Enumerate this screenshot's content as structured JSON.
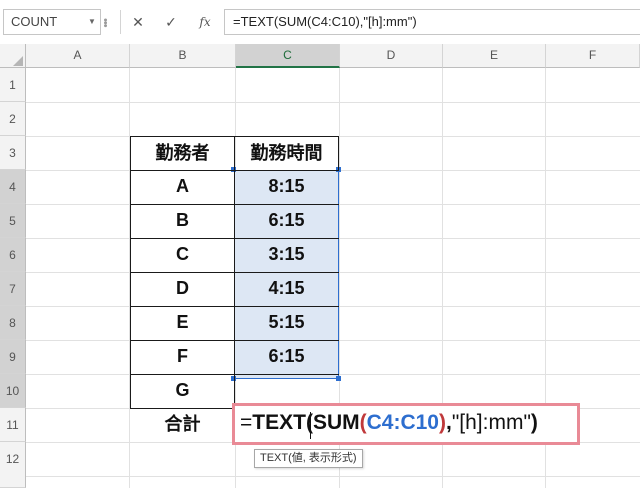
{
  "name_box": {
    "value": "COUNT"
  },
  "formula_bar": {
    "formula": "=TEXT(SUM(C4:C10),\"[h]:mm\")"
  },
  "columns": [
    "A",
    "B",
    "C",
    "D",
    "E",
    "F"
  ],
  "rows": [
    "1",
    "2",
    "3",
    "4",
    "5",
    "6",
    "7",
    "8",
    "9",
    "10",
    "11",
    "12"
  ],
  "table": {
    "header_worker": "勤務者",
    "header_hours": "勤務時間",
    "workers": [
      "A",
      "B",
      "C",
      "D",
      "E",
      "F",
      "G"
    ],
    "hours": [
      "8:15",
      "6:15",
      "3:15",
      "4:15",
      "5:15",
      "6:15",
      ""
    ],
    "total_label": "合計"
  },
  "edit": {
    "eq": "=",
    "func": "TEXT",
    "open1": "(",
    "sum": "SUM",
    "open2": "(",
    "range": "C4:C10",
    "close2": ")",
    "comma": ",",
    "format_arg": "\"[h]:mm\"",
    "close1": ")"
  },
  "tooltip": {
    "text": "TEXT(値, 表示形式)"
  },
  "colors": {
    "selection_border": "#2d6ecf",
    "selection_fill": "#dde7f4",
    "edit_border": "#e98a96",
    "range_ref": "#2d6ecf"
  }
}
